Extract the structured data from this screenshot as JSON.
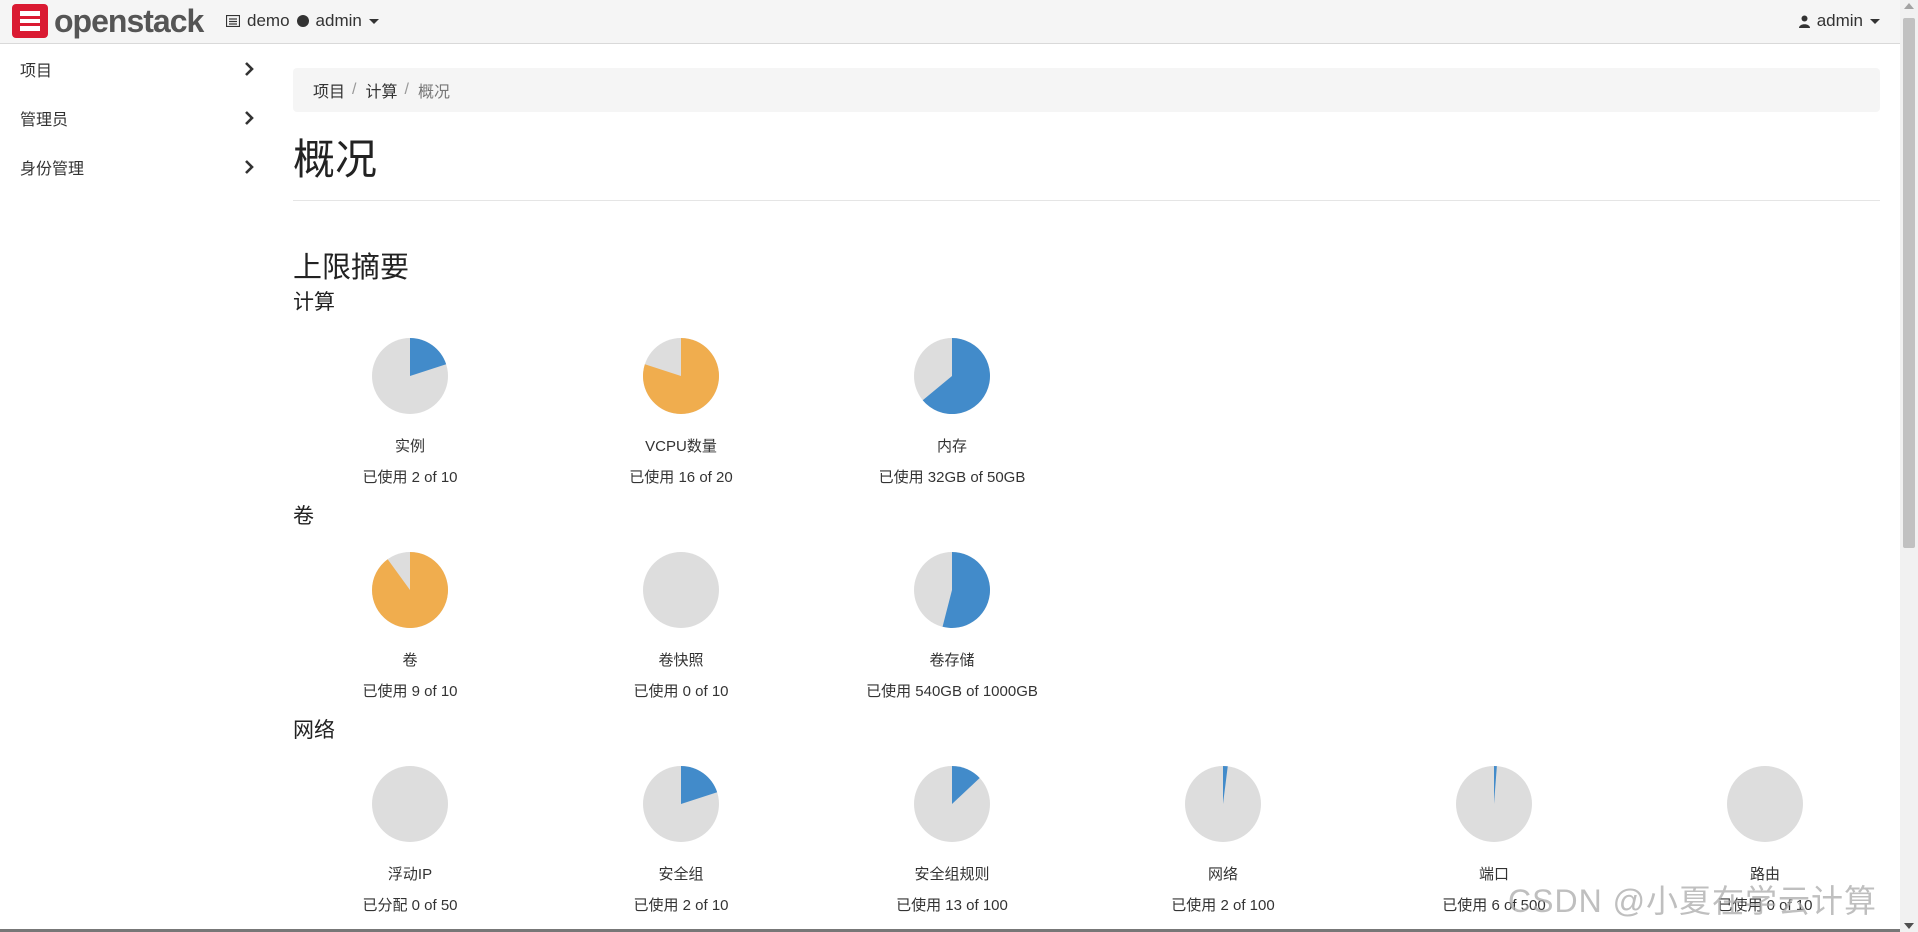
{
  "brand": {
    "name": "openstack",
    "mark": "openstack-logo"
  },
  "project_picker": {
    "project": "demo",
    "user": "admin"
  },
  "user_menu": {
    "label": "admin"
  },
  "sidebar": {
    "items": [
      {
        "label": "项目"
      },
      {
        "label": "管理员"
      },
      {
        "label": "身份管理"
      }
    ]
  },
  "breadcrumb": {
    "items": [
      "项目",
      "计算",
      "概况"
    ]
  },
  "page": {
    "title": "概况"
  },
  "limits": {
    "section_title": "上限摘要",
    "groups": [
      {
        "title": "计算",
        "charts": [
          {
            "label": "实例",
            "usage": "已使用 2 of 10",
            "used": 2,
            "total": 10
          },
          {
            "label": "VCPU数量",
            "usage": "已使用 16 of 20",
            "used": 16,
            "total": 20
          },
          {
            "label": "内存",
            "usage": "已使用 32GB of 50GB",
            "used": 32,
            "total": 50
          }
        ]
      },
      {
        "title": "卷",
        "charts": [
          {
            "label": "卷",
            "usage": "已使用 9 of 10",
            "used": 9,
            "total": 10
          },
          {
            "label": "卷快照",
            "usage": "已使用 0 of 10",
            "used": 0,
            "total": 10
          },
          {
            "label": "卷存储",
            "usage": "已使用 540GB of 1000GB",
            "used": 540,
            "total": 1000
          }
        ]
      },
      {
        "title": "网络",
        "charts": [
          {
            "label": "浮动IP",
            "usage": "已分配 0 of 50",
            "used": 0,
            "total": 50
          },
          {
            "label": "安全组",
            "usage": "已使用 2 of 10",
            "used": 2,
            "total": 10
          },
          {
            "label": "安全组规则",
            "usage": "已使用 13 of 100",
            "used": 13,
            "total": 100
          },
          {
            "label": "网络",
            "usage": "已使用 2 of 100",
            "used": 2,
            "total": 100
          },
          {
            "label": "端口",
            "usage": "已使用 6 of 500",
            "used": 6,
            "total": 500
          },
          {
            "label": "路由",
            "usage": "已使用 0 of 10",
            "used": 0,
            "total": 10
          }
        ]
      }
    ]
  },
  "colors": {
    "normal": "#428bca",
    "warning": "#f0ad4e",
    "empty": "#dddddd",
    "brand": "#da1a32"
  },
  "watermark": "CSDN @小夏在学云计算"
}
